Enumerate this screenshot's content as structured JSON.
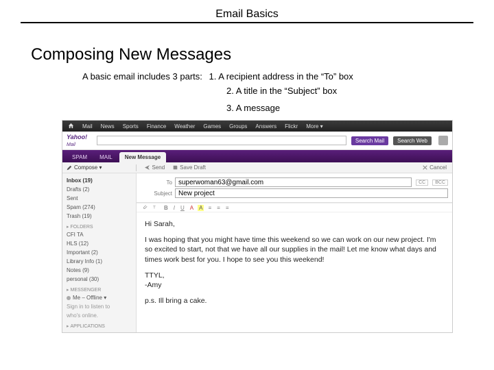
{
  "page": {
    "title": "Email Basics",
    "heading": "Composing New Messages",
    "intro_lead": "A basic email includes 3 parts:",
    "bullet1": "1. A recipient address in the “To” box",
    "bullet2": "2. A title in the “Subject” box",
    "bullet3": "3. A message"
  },
  "topnav": {
    "items": [
      "Mail",
      "News",
      "Sports",
      "Finance",
      "Weather",
      "Games",
      "Groups",
      "Answers",
      "Flickr",
      "More ▾"
    ]
  },
  "search": {
    "logo": "Yahoo!",
    "logo_sub": "Mail",
    "btn_mail": "Search Mail",
    "btn_web": "Search Web"
  },
  "tabs": {
    "spam": "SPAM",
    "mail": "MAIL",
    "active": "New Message"
  },
  "toolbar": {
    "compose": "Compose ▾",
    "send": "Send",
    "save": "Save Draft",
    "cancel": "Cancel"
  },
  "sidebar": {
    "items": [
      "Inbox (19)",
      "Drafts (2)",
      "Sent",
      "Spam (274)",
      "Trash (19)"
    ],
    "folders_label": "FOLDERS",
    "folders": [
      "CFI TA",
      "HLS (12)",
      "Important (2)",
      "Library Info (1)",
      "Notes (9)",
      "personal (30)"
    ],
    "messenger_label": "MESSENGER",
    "me_offline": "Me – Offline ▾",
    "signin1": "Sign in to listen to",
    "signin2": "who's online.",
    "apps_label": "APPLICATIONS"
  },
  "fields": {
    "to_label": "To",
    "cc": "CC",
    "bcc": "BCC",
    "subject_label": "Subject"
  },
  "values": {
    "to": "superwoman63@gmail.com",
    "subject": "New project"
  },
  "message": {
    "greeting": "Hi Sarah,",
    "body": "I was hoping that you might have time this weekend so we can work on our new project. I'm so excited to start, not that we have all our supplies in the mail! Let me know what days and times work best for you. I hope to see you this weekend!",
    "sign1": "TTYL,",
    "sign2": "-Amy",
    "ps": "p.s. Ill bring a cake."
  },
  "fmt": {
    "items": [
      "B",
      "I",
      "U",
      "A",
      "A",
      "≡",
      "≡",
      "≡"
    ]
  }
}
